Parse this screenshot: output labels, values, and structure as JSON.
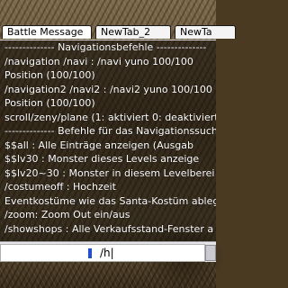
{
  "tabs": [
    {
      "label": "Battle Message"
    },
    {
      "label": "NewTab_2"
    },
    {
      "label": "NewTa"
    }
  ],
  "chat": {
    "lines": [
      "-------------- Navigationsbefehle --------------",
      "/navigation    /navi  :  /navi yuno 100/100",
      "Position (100/100)",
      "/navigation2  /navi2 :  /navi2 yuno 100/100",
      "Position (100/100)",
      "scroll/zeny/plane (1: aktiviert 0: deaktiviert",
      "-------------- Befehle für das Navigationssuch",
      "$$all         : Alle Einträge anzeigen (Ausgab",
      "$$lv30        : Monster dieses Levels anzeige",
      "$$lv20~30  : Monster in diesem Levelberei",
      "/costumeoff : Hochzeit",
      "Eventkostüme wie das Santa-Kostüm ableg",
      "/zoom: Zoom Out ein/aus",
      "/showshops : Alle Verkaufsstand-Fenster a"
    ]
  },
  "input": {
    "value": "/h|"
  },
  "colors": {
    "chat_text": "#ffffff",
    "input_marker": "#1e4fd8",
    "tab_border": "#1a1a1a"
  }
}
